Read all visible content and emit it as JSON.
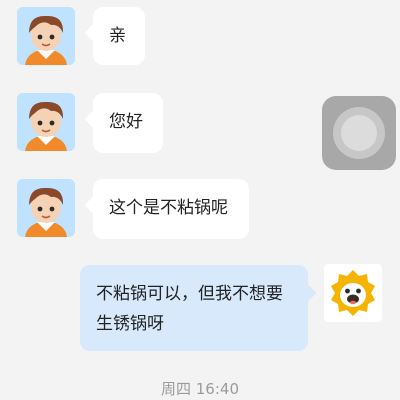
{
  "messages": [
    {
      "side": "in",
      "text": "亲"
    },
    {
      "side": "in",
      "text": "您好"
    },
    {
      "side": "in",
      "text": "这个是不粘锅呢"
    },
    {
      "side": "out",
      "text": "不粘锅可以，但我不想要\n生锈锅呀"
    }
  ],
  "timestamp": "周四 16:40",
  "icons": {
    "contact_avatar": "boy-avatar-icon",
    "self_avatar": "lion-avatar-icon",
    "assistive_touch": "assistive-touch-button"
  },
  "colors": {
    "background": "#f3f3f3",
    "incoming_bubble": "#ffffff",
    "outgoing_bubble": "#d7e9fb",
    "timestamp_text": "#9b9b9b"
  }
}
